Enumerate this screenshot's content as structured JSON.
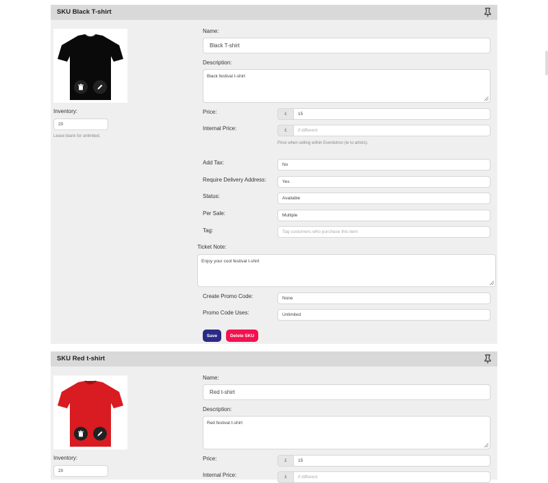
{
  "skus": [
    {
      "title": "SKU Black T-shirt",
      "image": "black-tshirt",
      "inventory_label": "Inventory:",
      "inventory_value": "20",
      "inventory_hint": "Leave blank for unlimited.",
      "name_label": "Name:",
      "name_value": "Black T-shirt",
      "description_label": "Description:",
      "description_value": "Black festival t-shirt",
      "price_label": "Price:",
      "currency": "£",
      "price_value": "15",
      "internal_price_label": "Internal Price:",
      "internal_price_placeholder": "if different",
      "internal_price_hint": "Price when selling within Eventotron (ie to artists).",
      "add_tax_label": "Add Tax:",
      "add_tax_value": "No",
      "delivery_label": "Require Delivery Address:",
      "delivery_value": "Yes",
      "status_label": "Status:",
      "status_value": "Available",
      "per_sale_label": "Per Sale:",
      "per_sale_value": "Multiple",
      "tag_label": "Tag:",
      "tag_placeholder": "Tag customers who purchase this item",
      "ticket_note_label": "Ticket Note:",
      "ticket_note_value": "Enjoy your cool festival t-shirt",
      "promo_label": "Create Promo Code:",
      "promo_value": "None",
      "promo_uses_label": "Promo Code Uses:",
      "promo_uses_value": "Unlimited",
      "save_label": "Save",
      "delete_label": "Delete SKU"
    },
    {
      "title": "SKU Red t-shirt",
      "image": "red-tshirt",
      "inventory_label": "Inventory:",
      "inventory_value": "20",
      "name_label": "Name:",
      "name_value": "Red t-shirt",
      "description_label": "Description:",
      "description_value": "Red festival t-shirt",
      "price_label": "Price:",
      "currency": "£",
      "price_value": "15",
      "internal_price_label": "Internal Price:",
      "internal_price_placeholder": "if different"
    }
  ],
  "colors": {
    "save": "#2b2a85",
    "delete": "#f3124f",
    "header": "#d9d9d9",
    "panel": "#efefef"
  },
  "icons": [
    "pin-icon",
    "trash-icon",
    "pencil-icon"
  ]
}
